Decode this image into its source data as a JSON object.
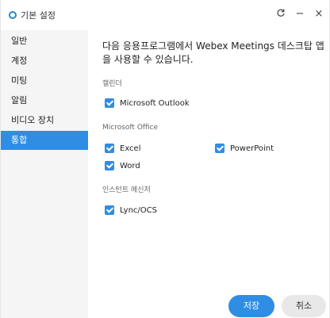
{
  "window": {
    "title": "기본 설정",
    "refresh_icon": "refresh-icon",
    "minimize_label": "−",
    "close_label": "×"
  },
  "sidebar": {
    "items": [
      {
        "label": "일반",
        "active": false
      },
      {
        "label": "계정",
        "active": false
      },
      {
        "label": "미팅",
        "active": false
      },
      {
        "label": "알림",
        "active": false
      },
      {
        "label": "비디오 장치",
        "active": false
      },
      {
        "label": "통합",
        "active": true
      }
    ]
  },
  "main": {
    "heading": "다음 응용프로그램에서 Webex Meetings 데스크탑 앱을 사용할 수 있습니다.",
    "sections": [
      {
        "label": "캘린더",
        "options": [
          {
            "label": "Microsoft Outlook",
            "checked": true
          }
        ]
      },
      {
        "label": "Microsoft Office",
        "options": [
          {
            "label": "Excel",
            "checked": true
          },
          {
            "label": "PowerPoint",
            "checked": true
          },
          {
            "label": "Word",
            "checked": true
          }
        ]
      },
      {
        "label": "인스턴트 메신저",
        "options": [
          {
            "label": "Lync/OCS",
            "checked": true
          }
        ]
      }
    ],
    "save_label": "저장",
    "cancel_label": "취소"
  },
  "colors": {
    "accent": "#2f8de4",
    "sidebar_bg": "#f5f5f5",
    "cancel_bg": "#e8e8e8"
  }
}
